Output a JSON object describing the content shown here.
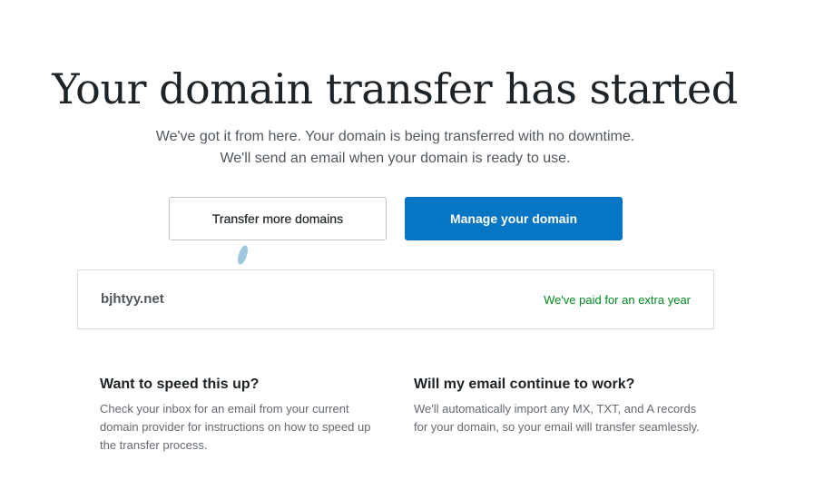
{
  "header": {
    "title": "Your domain transfer has started",
    "subtitle_line1": "We've got it from here. Your domain is being transferred with no downtime.",
    "subtitle_line2": "We'll send an email when your domain is ready to use."
  },
  "actions": {
    "transfer_more_label": "Transfer more domains",
    "manage_label": "Manage your domain"
  },
  "domain": {
    "name": "bjhtyy.net",
    "status": "We've paid for an extra year",
    "status_color": "#008a20"
  },
  "info": [
    {
      "title": "Want to speed this up?",
      "body": "Check your inbox for an email from your current domain provider for instructions on how to speed up the transfer process."
    },
    {
      "title": "Will my email continue to work?",
      "body": "We'll automatically import any MX, TXT, and A records for your domain, so your email will transfer seamlessly."
    }
  ],
  "colors": {
    "primary": "#0675c4",
    "text": "#1d2327",
    "muted": "#50575e"
  }
}
